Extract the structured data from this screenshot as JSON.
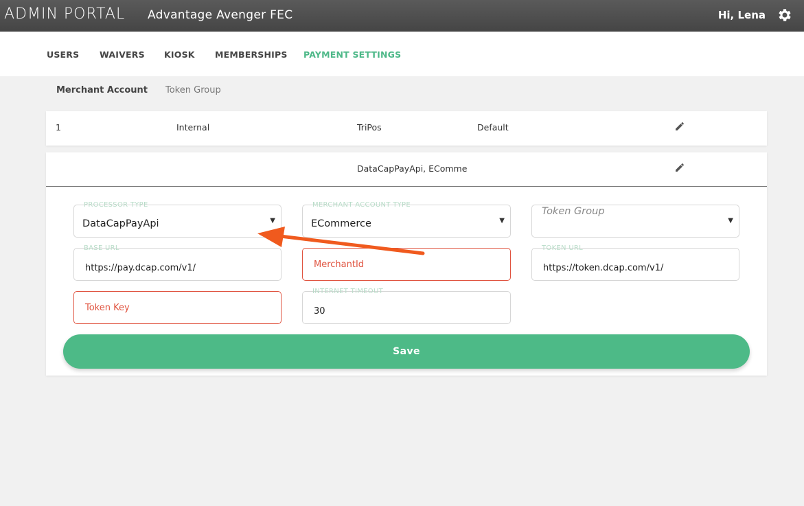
{
  "header": {
    "app_title": "ADMIN PORTAL",
    "subtitle": "Advantage Avenger FEC",
    "greeting": "Hi, Lena",
    "settings_icon": "gear-icon"
  },
  "nav": {
    "items": [
      {
        "label": "USERS",
        "active": false
      },
      {
        "label": "WAIVERS",
        "active": false
      },
      {
        "label": "KIOSK",
        "active": false
      },
      {
        "label": "MEMBERSHIPS",
        "active": false
      },
      {
        "label": "PAYMENT SETTINGS",
        "active": true
      }
    ],
    "accent_color": "#4db888"
  },
  "subtabs": [
    {
      "label": "Merchant Account",
      "active": true
    },
    {
      "label": "Token Group",
      "active": false
    }
  ],
  "accounts": [
    {
      "id": "1",
      "type": "Internal",
      "processor": "TriPos",
      "group": "Default"
    },
    {
      "processor": "DataCapPayApi, EComme"
    }
  ],
  "form": {
    "processor_type": {
      "label": "PROCESSOR TYPE",
      "value": "DataCapPayApi"
    },
    "merchant_account_type": {
      "label": "MERCHANT ACCOUNT TYPE",
      "value": "ECommerce"
    },
    "token_group": {
      "placeholder": "Token Group"
    },
    "base_url": {
      "label": "BASE URL",
      "value": "https://pay.dcap.com/v1/"
    },
    "merchant_id": {
      "placeholder": "MerchantId"
    },
    "token_url": {
      "label": "TOKEN URL",
      "value": "https://token.dcap.com/v1/"
    },
    "token_key": {
      "placeholder": "Token Key"
    },
    "internet_timeout": {
      "label": "INTERNET TIMEOUT",
      "value": "30"
    },
    "save_label": "Save",
    "save_color": "#4dba87",
    "error_color": "#e0533f"
  },
  "annotation": {
    "arrow_color": "#f05a1e"
  }
}
